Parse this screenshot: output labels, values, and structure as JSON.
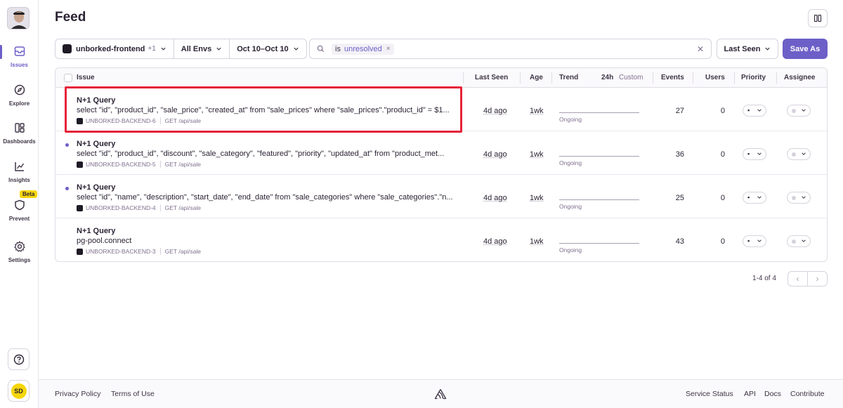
{
  "header": {
    "title": "Feed"
  },
  "sidebar": {
    "items": [
      {
        "label": "Issues",
        "icon": "issues-icon",
        "active": true
      },
      {
        "label": "Explore",
        "icon": "compass-icon"
      },
      {
        "label": "Dashboards",
        "icon": "dashboards-icon"
      },
      {
        "label": "Insights",
        "icon": "chart-icon"
      },
      {
        "label": "Prevent",
        "icon": "shield-icon",
        "badge": "Beta"
      },
      {
        "label": "Settings",
        "icon": "gear-icon"
      }
    ],
    "user_initials": "SD"
  },
  "filters": {
    "project": "unborked-frontend",
    "project_extra": "+1",
    "environment": "All Envs",
    "date_range": "Oct 10–Oct 10",
    "search_key": "is",
    "search_value": "unresolved",
    "sort": "Last Seen",
    "save_label": "Save As"
  },
  "table": {
    "headers": {
      "issue": "Issue",
      "last_seen": "Last Seen",
      "age": "Age",
      "trend": "Trend",
      "trend_24h": "24h",
      "trend_custom": "Custom",
      "events": "Events",
      "users": "Users",
      "priority": "Priority",
      "assignee": "Assignee"
    },
    "rows": [
      {
        "title": "N+1 Query",
        "message": "select \"id\", \"product_id\", \"sale_price\", \"created_at\" from \"sale_prices\" where \"sale_prices\".\"product_id\" = $1...",
        "short_id": "UNBORKED-BACKEND-6",
        "culprit": "GET /api/sale",
        "last_seen": "4d ago",
        "age": "1wk",
        "trend_label": "Ongoing",
        "events": "27",
        "users": "0",
        "unread": false
      },
      {
        "title": "N+1 Query",
        "message": "select \"id\", \"product_id\", \"discount\", \"sale_category\", \"featured\", \"priority\", \"updated_at\" from \"product_met...",
        "short_id": "UNBORKED-BACKEND-5",
        "culprit": "GET /api/sale",
        "last_seen": "4d ago",
        "age": "1wk",
        "trend_label": "Ongoing",
        "events": "36",
        "users": "0",
        "unread": true
      },
      {
        "title": "N+1 Query",
        "message": "select \"id\", \"name\", \"description\", \"start_date\", \"end_date\" from \"sale_categories\" where \"sale_categories\".\"n...",
        "short_id": "UNBORKED-BACKEND-4",
        "culprit": "GET /api/sale",
        "last_seen": "4d ago",
        "age": "1wk",
        "trend_label": "Ongoing",
        "events": "25",
        "users": "0",
        "unread": true
      },
      {
        "title": "N+1 Query",
        "message": "pg-pool.connect",
        "short_id": "UNBORKED-BACKEND-3",
        "culprit": "GET /api/sale",
        "last_seen": "4d ago",
        "age": "1wk",
        "trend_label": "Ongoing",
        "events": "43",
        "users": "0",
        "unread": false
      }
    ]
  },
  "pagination": {
    "label": "1-4 of 4"
  },
  "footer": {
    "privacy": "Privacy Policy",
    "terms": "Terms of Use",
    "status": "Service Status",
    "api": "API",
    "docs": "Docs",
    "contribute": "Contribute"
  },
  "colors": {
    "accent": "#6c5fc7",
    "highlight": "#e6233a",
    "beta": "#f5d60a"
  }
}
